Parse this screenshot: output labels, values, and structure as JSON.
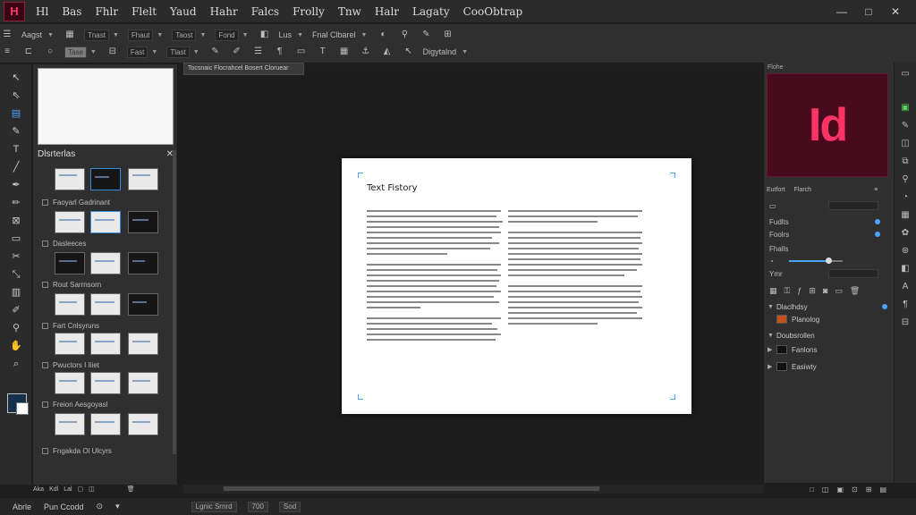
{
  "menubar": {
    "logo": "H",
    "items": [
      "Hl",
      "Bas",
      "Fhlr",
      "Flelt",
      "Yaud",
      "Hahr",
      "Falcs",
      "Frolly",
      "Tnw",
      "Halr",
      "Lagaty",
      "CooObtrap"
    ],
    "win_minimize": "—",
    "win_maximize": "□",
    "win_close": "✕"
  },
  "controlbar": {
    "row1": {
      "field1": "Aagst",
      "field2": "Tnast",
      "field3": "Fhaut",
      "field4": "Taost",
      "field5": "Fond",
      "field6": "Lus",
      "field7": "Fnal Clbarel"
    },
    "row2": {
      "field1": "Tase",
      "field2": "Fast",
      "field3": "Tlast",
      "field4": "Digytalnd"
    }
  },
  "pages_panel": {
    "title": "Dlsrterlas",
    "close": "✕",
    "sections": [
      {
        "label": "Faoyarl Gadrinant"
      },
      {
        "label": "Dasleeces"
      },
      {
        "label": "Rout Sarrnsorn"
      },
      {
        "label": "Fart Cnlsyruns"
      },
      {
        "label": "Pwuctors I Iiiet"
      },
      {
        "label": "Freion Aesgoyasl"
      },
      {
        "label": "Fngakda Ol Ulcyrs"
      }
    ],
    "footer": [
      "Aka",
      "Kdl",
      "Lal"
    ]
  },
  "document": {
    "tab_title": "Tocsnaic Flocrahcel Bosert Cloruear",
    "page_title": "Text Fistory"
  },
  "right_panel": {
    "tab": "Flohe",
    "logo_text": "Id",
    "tabs": [
      "Eutfort",
      "Flarch"
    ],
    "rows": [
      {
        "label": "Fudlts"
      },
      {
        "label": "Foolrs"
      },
      {
        "label": "Fhalls"
      },
      {
        "label": "Ymr"
      }
    ],
    "layers": [
      {
        "name": "Dlaclhdsy",
        "thumb_color": "#2a2a2a"
      },
      {
        "name": "Planolog",
        "thumb_color": "#c4501c"
      },
      {
        "name": "Doubsrollen",
        "thumb_color": "#2a2a2a"
      },
      {
        "name": "Fanlons",
        "thumb_color": "#111111"
      },
      {
        "name": "Easiwty",
        "thumb_color": "#111111"
      }
    ],
    "bottom_icons": [
      "□",
      "◫",
      "▣",
      "⊡",
      "⊞",
      "▤"
    ]
  },
  "statusbar": {
    "item1": "Abrle",
    "item2": "Pun Ccodd",
    "item3": "⊙",
    "field1": "Lgnic Srnrd",
    "field2": "700",
    "field3": "Sod"
  },
  "colors": {
    "accent": "#4aa3ff",
    "brand": "#ff3366",
    "brand_bg": "#4a0a1e"
  }
}
